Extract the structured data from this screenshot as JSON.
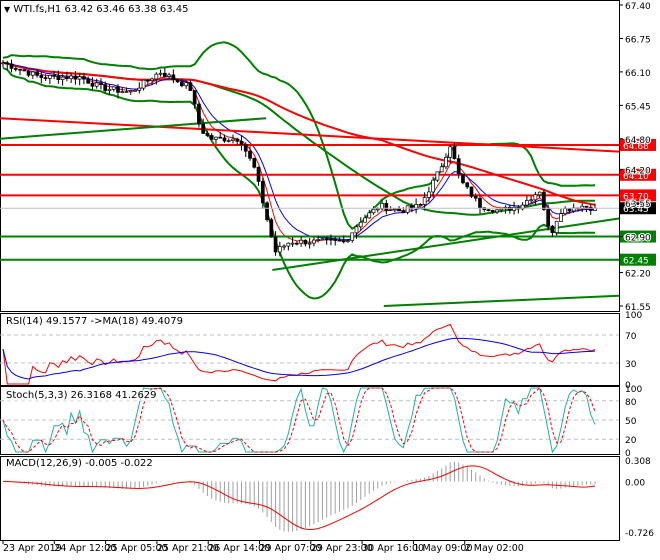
{
  "header": {
    "symbol": "WTI.fs,H1",
    "ohlc": "63.42 63.46 63.38 63.45"
  },
  "price_axis": {
    "ticks": [
      "67.40",
      "66.75",
      "66.10",
      "65.45",
      "64.80",
      "64.20",
      "63.55",
      "62.90",
      "62.20",
      "61.55"
    ],
    "min": 61.55,
    "max": 67.4
  },
  "levels": [
    {
      "label": "64.68",
      "value": 64.68,
      "color": "#ff0000"
    },
    {
      "label": "64.10",
      "value": 64.1,
      "color": "#ff0000"
    },
    {
      "label": "63.70",
      "value": 63.7,
      "color": "#ff0000"
    },
    {
      "label": "62.90",
      "value": 62.9,
      "color": "#008000"
    },
    {
      "label": "62.45",
      "value": 62.45,
      "color": "#008000"
    }
  ],
  "current_price": {
    "label": "63.45",
    "value": 63.45
  },
  "trendlines": [
    {
      "color": "#ff0000",
      "from": [
        0,
        65.2
      ],
      "to": [
        1,
        64.55
      ]
    },
    {
      "color": "#008000",
      "from": [
        0.44,
        62.25
      ],
      "to": [
        1,
        63.25
      ]
    },
    {
      "color": "#008000",
      "from": [
        0.62,
        61.55
      ],
      "to": [
        1,
        61.75
      ]
    },
    {
      "color": "#008000",
      "from": [
        0,
        64.8
      ],
      "to": [
        0.43,
        65.2
      ]
    }
  ],
  "closes_keypoints": [
    [
      0,
      66.3
    ],
    [
      40,
      66.0
    ],
    [
      80,
      66.0
    ],
    [
      100,
      65.8
    ],
    [
      130,
      65.7
    ],
    [
      160,
      66.1
    ],
    [
      190,
      65.8
    ],
    [
      200,
      65.0
    ],
    [
      210,
      64.8
    ],
    [
      240,
      64.8
    ],
    [
      255,
      64.2
    ],
    [
      265,
      63.4
    ],
    [
      275,
      62.6
    ],
    [
      290,
      62.8
    ],
    [
      320,
      62.8
    ],
    [
      345,
      62.8
    ],
    [
      360,
      63.2
    ],
    [
      380,
      63.5
    ],
    [
      400,
      63.4
    ],
    [
      420,
      63.5
    ],
    [
      440,
      64.2
    ],
    [
      450,
      64.7
    ],
    [
      460,
      64.0
    ],
    [
      480,
      63.5
    ],
    [
      500,
      63.4
    ],
    [
      520,
      63.5
    ],
    [
      540,
      63.8
    ],
    [
      550,
      62.9
    ],
    [
      560,
      63.4
    ],
    [
      580,
      63.5
    ],
    [
      595,
      63.45
    ]
  ],
  "rsi": {
    "title": "RSI(14) 49.1577  ->MA(18) 49.4079",
    "ticks": [
      "100",
      "70",
      "30",
      "0"
    ]
  },
  "stoch": {
    "title": "Stoch(5,3,3) 26.3168 41.2629",
    "ticks": [
      "100",
      "80",
      "50",
      "20",
      "0"
    ]
  },
  "macd": {
    "title": "MACD(12,26,9) -0.005 -0.022",
    "ticks": [
      "0.308",
      "0.00",
      "-0.726"
    ]
  },
  "time_axis": [
    "23 Apr 2019",
    "24 Apr 12:00",
    "25 Apr 05:00",
    "25 Apr 21:00",
    "26 Apr 14:00",
    "29 Apr 07:00",
    "29 Apr 23:00",
    "30 Apr 16:00",
    "1 May 09:00",
    "2 May 02:00"
  ],
  "colors": {
    "bb": "#008000",
    "ma_fast": "#ff0000",
    "ma_slow": "#0000ff",
    "rsi": "#ff0000",
    "rsi_ma": "#0000ff",
    "stoch_k": "#20b2aa",
    "stoch_d": "#ff0000",
    "macd": "#ff0000"
  }
}
